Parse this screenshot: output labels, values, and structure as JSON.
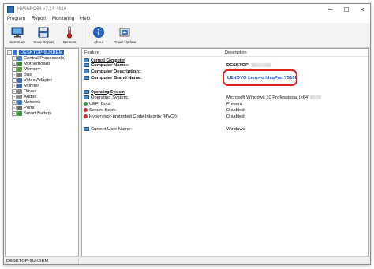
{
  "window": {
    "title": "HWiNFO64 v7.14-4610",
    "minimize": "─",
    "maximize": "☐",
    "close": "✕"
  },
  "menu": [
    "Program",
    "Report",
    "Monitoring",
    "Help"
  ],
  "toolbar": [
    {
      "label": "Summary",
      "icon": "monitor-icon"
    },
    {
      "label": "Save Report",
      "icon": "save-icon"
    },
    {
      "label": "Sensors",
      "icon": "thermometer-icon"
    },
    {
      "label": "About",
      "icon": "info-icon"
    },
    {
      "label": "Driver Update",
      "icon": "driver-update-icon"
    }
  ],
  "tree": {
    "root": "DESKTOP-9UKBEM",
    "items": [
      {
        "label": "Central Processor(s)",
        "icon_color": "#4a7fc0"
      },
      {
        "label": "Motherboard",
        "icon_color": "#3f8a3f"
      },
      {
        "label": "Memory",
        "icon_color": "#5a9a3a"
      },
      {
        "label": "Bus",
        "icon_color": "#7a7a7a"
      },
      {
        "label": "Video Adapter",
        "icon_color": "#3a6ab0"
      },
      {
        "label": "Monitor",
        "icon_color": "#3a6ab0"
      },
      {
        "label": "Drives",
        "icon_color": "#888888"
      },
      {
        "label": "Audio",
        "icon_color": "#909090"
      },
      {
        "label": "Network",
        "icon_color": "#3a7ac0"
      },
      {
        "label": "Ports",
        "icon_color": "#6a6a6a"
      },
      {
        "label": "Smart Battery",
        "icon_color": "#3a9a3a"
      }
    ]
  },
  "details": {
    "col_feature": "Feature",
    "col_description": "Description",
    "section_computer": "Current Computer",
    "computer_name_label": "Computer Name:",
    "computer_name_value": "DESKTOP-",
    "computer_desc_label": "Computer Description:",
    "brand_label": "Computer Brand Name:",
    "brand_value": "LENOVO Lenovo IdeaPad Y510P",
    "section_os": "Operating System",
    "os_label": "Operating System:",
    "os_value": "Microsoft Windows 10 Professional (x64)",
    "uefi_label": "UEFI Boot:",
    "uefi_value": "Present",
    "secure_label": "Secure Boot:",
    "secure_value": "Disabled",
    "hvci_label": "Hypervisor-protected Code Integrity (HVCI):",
    "hvci_value": "Disabled",
    "user_label": "Current User Name:",
    "user_value": "Windows"
  },
  "status": {
    "text": "DESKTOP-9UKBEM"
  },
  "colors": {
    "selection": "#1e64c8",
    "highlight_border": "#e02020",
    "brand_text": "#1a4fd0",
    "shield_green": "#2e9a3a",
    "shield_red": "#d03030"
  }
}
